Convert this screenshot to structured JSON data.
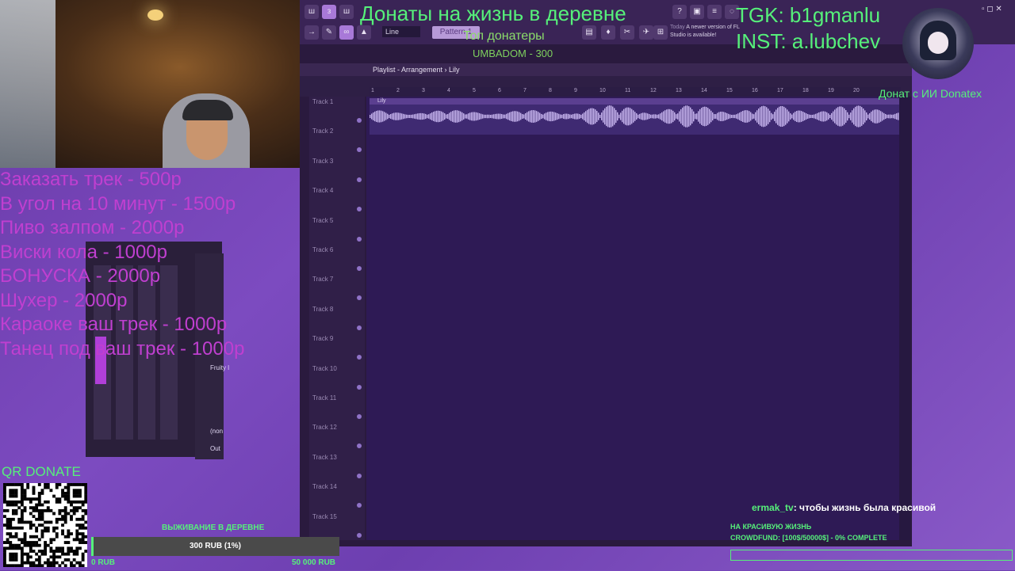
{
  "stream": {
    "headline": "Донаты на жизнь в деревне",
    "top_donors_title": "Топ донатеры",
    "top_donors": [
      "UMBADOM - 300"
    ],
    "tgk": "TGK: b1gmanlu",
    "inst": "INST: a.lubchev",
    "donatex": "Донат с ИИ Donatex",
    "qr_label": "QR DONATE",
    "price_list": [
      "Заказать трек - 500р",
      "В угол на 10 минут - 1500р",
      "Пиво залпом - 2000р",
      "Виски кола - 1000р",
      "БОНУСКА - 2000р",
      "Шухер - 2000р",
      "Караоке ваш трек - 1000р",
      "Танец под ваш трек - 1000р"
    ],
    "goal": {
      "label": "ВЫЖИВАНИЕ В ДЕРЕВНЕ",
      "progress_text": "300 RUB (1%)",
      "progress_fraction": 0.01,
      "min": "0 RUB",
      "max": "50 000 RUB"
    },
    "chat": {
      "user": "ermak_tv",
      "message": ": чтобы жизнь была красивой"
    },
    "crowdfund": {
      "title": "НА КРАСИВУЮ ЖИЗНЬ",
      "status": "CROWDFUND: [100$/50000$] - 0% COMPLETE"
    }
  },
  "fl": {
    "line_mode": "Line",
    "pattern": "Pattern 1",
    "notice_time": "Today",
    "notice_text": "A newer version of FL Studio is available!",
    "playlist_title": "Playlist - Arrangement › Lily",
    "clip_name": "Lily",
    "timeline": [
      "1",
      "2",
      "3",
      "4",
      "5",
      "6",
      "7",
      "8",
      "9",
      "10",
      "11",
      "12",
      "13",
      "14",
      "15",
      "16",
      "17",
      "18",
      "19",
      "20"
    ],
    "tracks": [
      "Track 1",
      "Track 2",
      "Track 3",
      "Track 4",
      "Track 5",
      "Track 6",
      "Track 7",
      "Track 8",
      "Track 9",
      "Track 10",
      "Track 11",
      "Track 12",
      "Track 13",
      "Track 14",
      "Track 15"
    ],
    "mixer_side": [
      "Fruity l",
      "(non",
      "Out"
    ]
  },
  "colors": {
    "accent_green": "#56f07a",
    "price_magenta": "#c03fd0",
    "bg_purple": "#6a3aa8"
  }
}
